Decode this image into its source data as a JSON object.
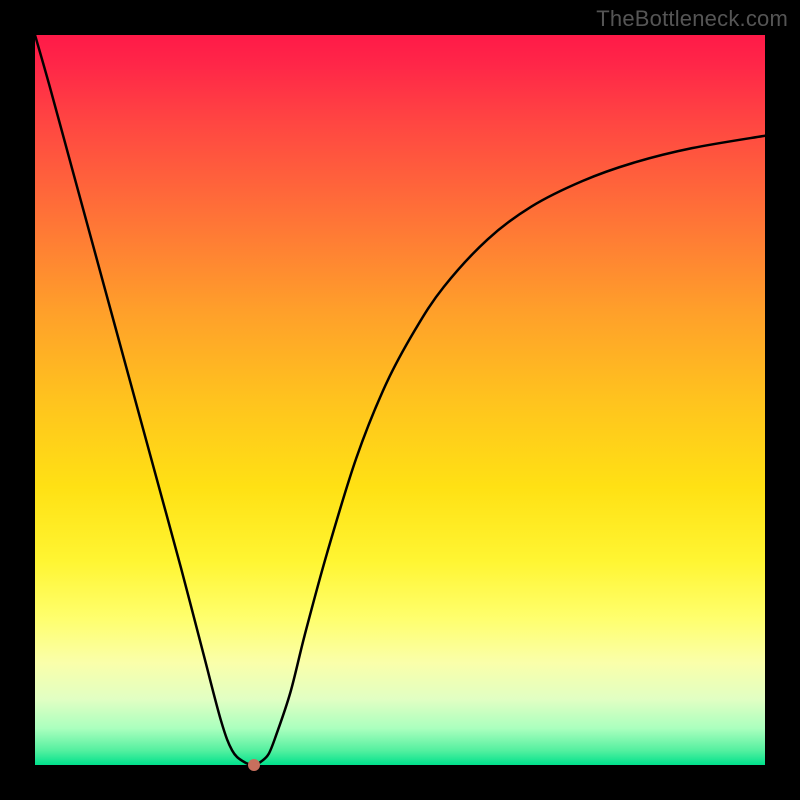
{
  "watermark": "TheBottleneck.com",
  "chart_data": {
    "type": "line",
    "title": "",
    "xlabel": "",
    "ylabel": "",
    "xlim": [
      0,
      1
    ],
    "ylim": [
      0,
      1
    ],
    "grid": false,
    "background": "rainbow-gradient-vertical",
    "series": [
      {
        "name": "bottleneck-curve",
        "color": "#000000",
        "x": [
          0.0,
          0.02,
          0.05,
          0.08,
          0.11,
          0.14,
          0.17,
          0.2,
          0.23,
          0.255,
          0.27,
          0.285,
          0.3,
          0.31,
          0.32,
          0.33,
          0.35,
          0.37,
          0.4,
          0.44,
          0.48,
          0.52,
          0.56,
          0.62,
          0.68,
          0.75,
          0.82,
          0.9,
          1.0
        ],
        "y": [
          1.0,
          0.93,
          0.82,
          0.71,
          0.6,
          0.49,
          0.38,
          0.27,
          0.155,
          0.06,
          0.02,
          0.005,
          0.0,
          0.005,
          0.015,
          0.04,
          0.1,
          0.18,
          0.29,
          0.42,
          0.52,
          0.595,
          0.655,
          0.72,
          0.765,
          0.8,
          0.825,
          0.845,
          0.862
        ]
      }
    ],
    "marker": {
      "x": 0.3,
      "y": 0.0,
      "color": "rgb(199,111,93)"
    }
  }
}
